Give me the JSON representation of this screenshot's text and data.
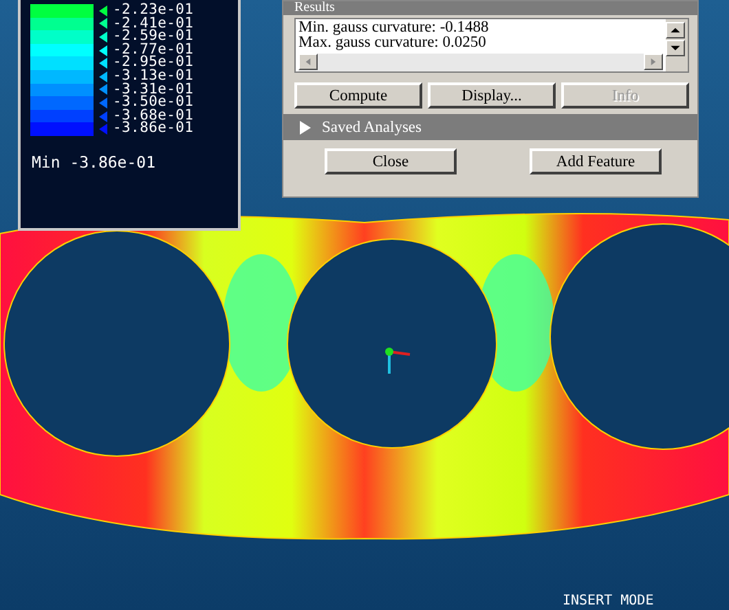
{
  "legend": {
    "items": [
      {
        "label": "-2.23e-01",
        "color": "#00ff40"
      },
      {
        "label": "-2.41e-01",
        "color": "#00ff90"
      },
      {
        "label": "-2.59e-01",
        "color": "#00ffc8"
      },
      {
        "label": "-2.77e-01",
        "color": "#00ffff"
      },
      {
        "label": "-2.95e-01",
        "color": "#00e0ff"
      },
      {
        "label": "-3.13e-01",
        "color": "#00b8ff"
      },
      {
        "label": "-3.31e-01",
        "color": "#0090ff"
      },
      {
        "label": "-3.50e-01",
        "color": "#0068ff"
      },
      {
        "label": "-3.68e-01",
        "color": "#0040ff"
      },
      {
        "label": "-3.86e-01",
        "color": "#0010ff"
      }
    ],
    "min_label": "Min -3.86e-01"
  },
  "dialog": {
    "section_title": "Results",
    "results": [
      "Min. gauss curvature: -0.1488",
      "Max. gauss curvature: 0.0250"
    ],
    "buttons": [
      {
        "label": "Compute",
        "disabled": false
      },
      {
        "label": "Display...",
        "disabled": false
      },
      {
        "label": "Info",
        "disabled": true
      }
    ],
    "saved_analyses": {
      "label": "Saved Analyses",
      "expanded": false
    },
    "footer_buttons": [
      "Close",
      "Add Feature"
    ]
  },
  "status_bar": {
    "mode": "INSERT MODE"
  }
}
